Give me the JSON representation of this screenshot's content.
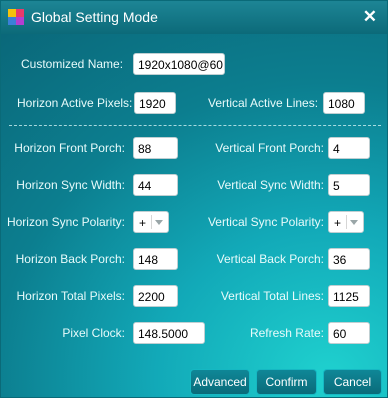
{
  "window": {
    "title": "Global Setting Mode",
    "close_glyph": "✕"
  },
  "colors": {
    "accent": "#0c7e8f",
    "titlebar": "#0c6a79",
    "highlight": "#1fd1cf"
  },
  "fields": {
    "customized_name": {
      "label": "Customized Name:",
      "value": "1920x1080@60"
    },
    "h_active": {
      "label": "Horizon Active Pixels:",
      "value": "1920"
    },
    "v_active": {
      "label": "Vertical Active Lines:",
      "value": "1080"
    },
    "h_front": {
      "label": "Horizon Front Porch:",
      "value": "88"
    },
    "v_front": {
      "label": "Vertical Front Porch:",
      "value": "4"
    },
    "h_sync_width": {
      "label": "Horizon Sync Width:",
      "value": "44"
    },
    "v_sync_width": {
      "label": "Vertical Sync Width:",
      "value": "5"
    },
    "h_sync_pol": {
      "label": "Horizon Sync Polarity:",
      "value": "+"
    },
    "v_sync_pol": {
      "label": "Vertical Sync Polarity:",
      "value": "+"
    },
    "h_back": {
      "label": "Horizon Back Porch:",
      "value": "148"
    },
    "v_back": {
      "label": "Vertical  Back Porch:",
      "value": "36"
    },
    "h_total": {
      "label": "Horizon Total Pixels:",
      "value": "2200"
    },
    "v_total": {
      "label": "Vertical Total Lines:",
      "value": "1125"
    },
    "pixel_clock": {
      "label": "Pixel Clock:",
      "value": "148.5000"
    },
    "refresh_rate": {
      "label": "Refresh Rate:",
      "value": "60"
    }
  },
  "buttons": {
    "advanced": "Advanced",
    "confirm": "Confirm",
    "cancel": "Cancel"
  }
}
